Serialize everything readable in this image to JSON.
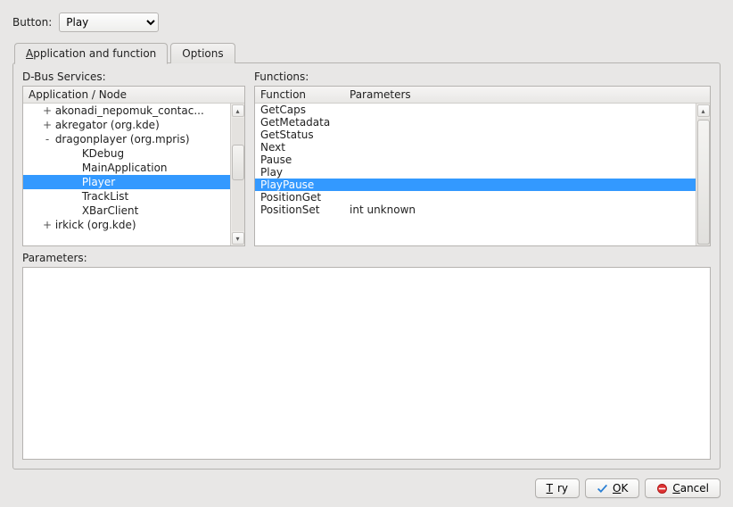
{
  "top": {
    "button_label": "Button:",
    "button_value": "Play"
  },
  "tabs": {
    "application": "Application and function",
    "options": "Options"
  },
  "left": {
    "title": "D-Bus Services:",
    "header": "Application / Node",
    "tree": [
      {
        "expander": "+",
        "label": "akonadi_nepomuk_contac...",
        "depth": 1
      },
      {
        "expander": "+",
        "label": "akregator (org.kde)",
        "depth": 1
      },
      {
        "expander": "-",
        "label": "dragonplayer (org.mpris)",
        "depth": 1
      },
      {
        "expander": "",
        "label": "KDebug",
        "depth": 2
      },
      {
        "expander": "",
        "label": "MainApplication",
        "depth": 2
      },
      {
        "expander": "",
        "label": "Player",
        "depth": 2,
        "selected": true
      },
      {
        "expander": "",
        "label": "TrackList",
        "depth": 2
      },
      {
        "expander": "",
        "label": "XBarClient",
        "depth": 2
      },
      {
        "expander": "+",
        "label": "irkick (org.kde)",
        "depth": 1
      }
    ]
  },
  "right": {
    "title": "Functions:",
    "header_fn": "Function",
    "header_pm": "Parameters",
    "rows": [
      {
        "fn": "GetCaps",
        "pm": ""
      },
      {
        "fn": "GetMetadata",
        "pm": ""
      },
      {
        "fn": "GetStatus",
        "pm": ""
      },
      {
        "fn": "Next",
        "pm": ""
      },
      {
        "fn": "Pause",
        "pm": ""
      },
      {
        "fn": "Play",
        "pm": ""
      },
      {
        "fn": "PlayPause",
        "pm": "",
        "selected": true
      },
      {
        "fn": "PositionGet",
        "pm": ""
      },
      {
        "fn": "PositionSet",
        "pm": "int unknown"
      }
    ]
  },
  "params_label": "Parameters:",
  "buttons": {
    "try": "Try",
    "ok": "OK",
    "cancel": "Cancel"
  }
}
